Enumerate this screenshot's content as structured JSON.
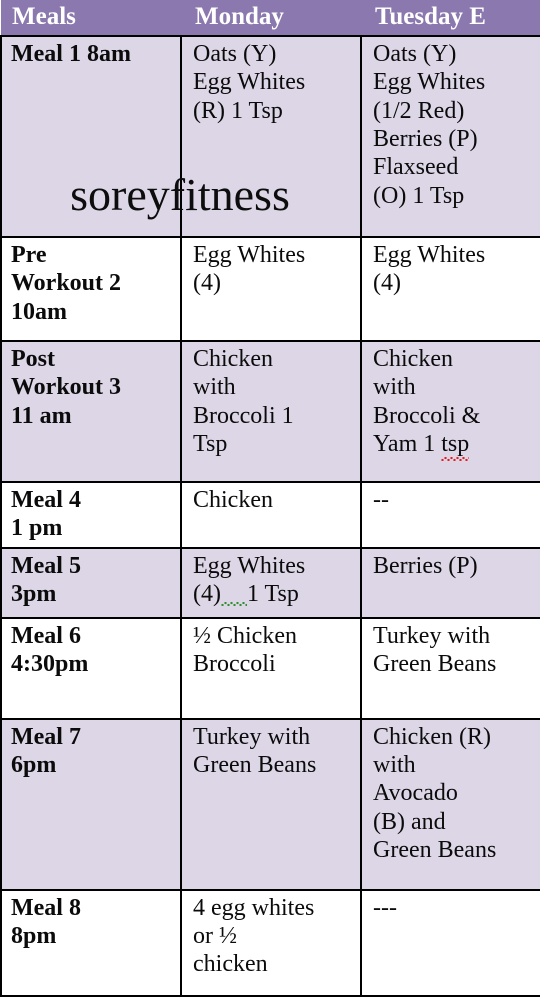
{
  "table": {
    "headers": [
      "Meals",
      "Monday",
      "Tuesday E"
    ],
    "rows": [
      {
        "shaded": true,
        "meal": "Meal 1 8am",
        "monday": "Oats (Y)\nEgg Whites\n(R) 1 Tsp",
        "tuesday": "Oats (Y)\nEgg Whites\n(1/2 Red)\nBerries (P)\nFlaxseed\n(O) 1 Tsp"
      },
      {
        "shaded": false,
        "meal": "Pre\nWorkout 2\n10am",
        "monday": "Egg Whites\n(4)",
        "tuesday": "Egg Whites\n(4)"
      },
      {
        "shaded": true,
        "meal": "Post\nWorkout 3\n11 am",
        "monday": "Chicken\nwith\nBroccoli 1\nTsp",
        "tuesday": "Chicken\nwith\nBroccoli  &\nYam 1 tsp",
        "tuesday_misspelled": "tsp"
      },
      {
        "shaded": false,
        "meal": "Meal 4\n1 pm",
        "monday": "Chicken",
        "tuesday": "--"
      },
      {
        "shaded": true,
        "meal": "Meal 5\n3pm",
        "monday": "Egg Whites\n(4)   1 Tsp",
        "tuesday": "Berries (P)",
        "monday_grammar_gap": true
      },
      {
        "shaded": false,
        "meal": "Meal 6\n4:30pm",
        "monday": "½ Chicken\nBroccoli",
        "tuesday": "Turkey with\nGreen Beans"
      },
      {
        "shaded": true,
        "meal": "Meal 7\n6pm",
        "monday": "Turkey with\nGreen Beans",
        "tuesday": "Chicken (R)\nwith\nAvocado\n(B) and\nGreen Beans"
      },
      {
        "shaded": false,
        "meal": "Meal 8\n8pm",
        "monday": "4 egg whites\nor ½\nchicken",
        "tuesday": "---"
      }
    ]
  },
  "watermark": {
    "text": "soreyfitness"
  },
  "colors": {
    "header_bg": "#8b78ae",
    "header_text": "#ffffff",
    "shaded_row_bg": "#ddd6e6",
    "plain_row_bg": "#ffffff",
    "border": "#000000",
    "spellcheck_red": "#e02020",
    "grammar_green": "#2f8f2f"
  }
}
